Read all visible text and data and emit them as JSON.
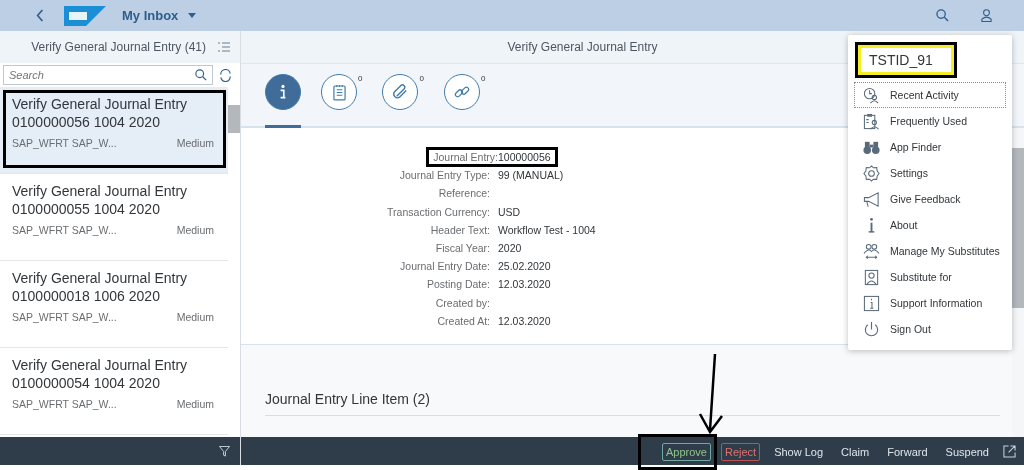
{
  "header": {
    "app_title": "My Inbox"
  },
  "list_panel": {
    "title": "Verify General Journal Entry (41)",
    "search": {
      "placeholder": "Search"
    },
    "items": [
      {
        "title": "Verify General Journal Entry",
        "subtitle": "0100000056 1004 2020",
        "created_by": "SAP_WFRT SAP_W...",
        "priority": "Medium",
        "selected": true,
        "annotated": true
      },
      {
        "title": "Verify General Journal Entry",
        "subtitle": "0100000055 1004 2020",
        "created_by": "SAP_WFRT SAP_W...",
        "priority": "Medium",
        "selected": false,
        "annotated": false
      },
      {
        "title": "Verify General Journal Entry",
        "subtitle": "0100000018 1006 2020",
        "created_by": "SAP_WFRT SAP_W...",
        "priority": "Medium",
        "selected": false,
        "annotated": false
      },
      {
        "title": "Verify General Journal Entry",
        "subtitle": "0100000054 1004 2020",
        "created_by": "SAP_WFRT SAP_W...",
        "priority": "Medium",
        "selected": false,
        "annotated": false
      }
    ]
  },
  "detail": {
    "title": "Verify General Journal Entry",
    "tabs": [
      {
        "kind": "info",
        "selected": true
      },
      {
        "kind": "notes",
        "count": "0",
        "selected": false
      },
      {
        "kind": "attachments",
        "count": "0",
        "selected": false
      },
      {
        "kind": "links",
        "count": "0",
        "selected": false
      }
    ],
    "fields": [
      {
        "label": "Journal Entry:",
        "value": "100000056",
        "annotated": true
      },
      {
        "label": "Journal Entry Type:",
        "value": "99 (MANUAL)",
        "annotated": false
      },
      {
        "label": "Reference:",
        "annotated": false
      },
      {
        "label": "Transaction Currency:",
        "value": "USD",
        "annotated": false
      },
      {
        "label": "Header Text:",
        "value": "Workflow Test - 1004",
        "annotated": false
      },
      {
        "label": "Fiscal Year:",
        "value": "2020",
        "annotated": false
      },
      {
        "label": "Journal Entry Date:",
        "value": "25.02.2020",
        "annotated": false
      },
      {
        "label": "Posting Date:",
        "value": "12.03.2020",
        "annotated": false
      },
      {
        "label": "Created by:",
        "annotated": false
      },
      {
        "label": "Created At:",
        "value": "12.03.2020",
        "annotated": false
      }
    ],
    "section_title": "Journal Entry Line Item (2)"
  },
  "footer": {
    "actions": [
      {
        "label": "Approve",
        "kind": "accept",
        "annotated": true
      },
      {
        "label": "Reject",
        "kind": "reject",
        "annotated": false
      },
      {
        "label": "Show Log",
        "kind": "plain",
        "annotated": false
      },
      {
        "label": "Claim",
        "kind": "plain",
        "annotated": false
      },
      {
        "label": "Forward",
        "kind": "plain",
        "annotated": false
      },
      {
        "label": "Suspend",
        "kind": "plain",
        "annotated": false
      }
    ]
  },
  "user_menu": {
    "user_id": "TSTID_91",
    "items": [
      {
        "label": "Recent Activity",
        "focused": true
      },
      {
        "label": "Frequently Used",
        "focused": false
      },
      {
        "label": "App Finder",
        "focused": false
      },
      {
        "label": "Settings",
        "focused": false
      },
      {
        "label": "Give Feedback",
        "focused": false
      },
      {
        "label": "About",
        "focused": false
      },
      {
        "label": "Manage My Substitutes",
        "focused": false
      },
      {
        "label": "Substitute for",
        "focused": false
      },
      {
        "label": "Support Information",
        "focused": false
      },
      {
        "label": "Sign Out",
        "focused": false
      }
    ]
  }
}
